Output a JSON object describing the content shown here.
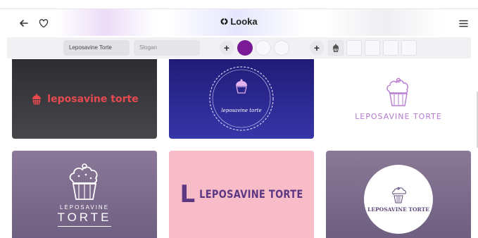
{
  "header": {
    "brand": "Looka",
    "back_icon": "arrow-left-icon",
    "favorite_icon": "heart-outline-icon",
    "menu_icon": "hamburger-menu-icon"
  },
  "toolbar": {
    "company_name_value": "Leposavine Torte",
    "slogan_placeholder": "Slogan",
    "add_color_label": "+",
    "add_symbol_label": "+",
    "selected_color": "#7b1a96"
  },
  "logos": [
    {
      "text": "leposavine torte",
      "color": "#e8494f"
    },
    {
      "text": "leposavine torte",
      "color": "#ffffff"
    },
    {
      "text": "LEPOSAVINE TORTE",
      "color": "#b67ad0"
    },
    {
      "line1": "LEPOSAVINE",
      "line2": "TORTE",
      "color": "#ffffff"
    },
    {
      "letter": "L",
      "text": "LEPOSAVINE TORTE",
      "color": "#5d3882"
    },
    {
      "text": "LEPOSAVINE TORTE",
      "color": "#5d4a78"
    }
  ]
}
